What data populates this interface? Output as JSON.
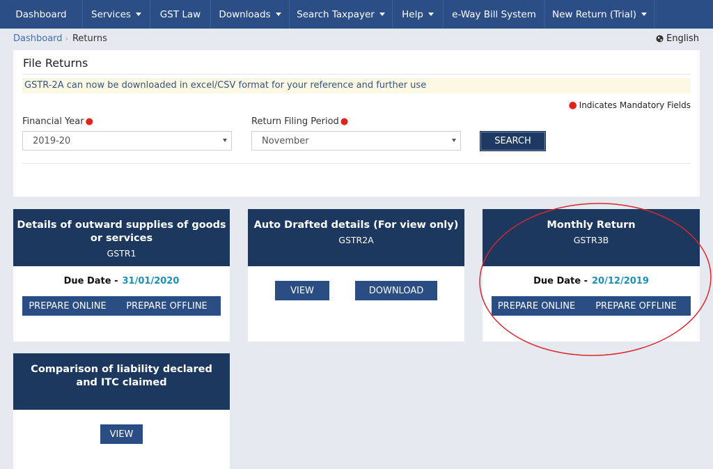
{
  "nav": {
    "items": [
      {
        "label": "Dashboard",
        "dropdown": false
      },
      {
        "label": "Services",
        "dropdown": true
      },
      {
        "label": "GST Law",
        "dropdown": false
      },
      {
        "label": "Downloads",
        "dropdown": true
      },
      {
        "label": "Search Taxpayer",
        "dropdown": true
      },
      {
        "label": "Help",
        "dropdown": true
      },
      {
        "label": "e-Way Bill System",
        "dropdown": false
      },
      {
        "label": "New Return (Trial)",
        "dropdown": true
      }
    ]
  },
  "breadcrumb": {
    "home": "Dashboard",
    "current": "Returns"
  },
  "language": "English",
  "file_returns": {
    "title": "File Returns",
    "notice": "GSTR-2A can now be downloaded in excel/CSV format for your reference and further use",
    "mandatory_note": "Indicates Mandatory Fields",
    "financial_year": {
      "label": "Financial Year",
      "value": "2019-20"
    },
    "filing_period": {
      "label": "Return Filing Period",
      "value": "November"
    },
    "search_label": "SEARCH"
  },
  "cards": {
    "gstr1": {
      "title": "Details of outward supplies of goods or services",
      "form": "GSTR1",
      "due_label": "Due Date -",
      "due_date": "31/01/2020",
      "prepare_online": "PREPARE ONLINE",
      "prepare_offline": "PREPARE OFFLINE"
    },
    "gstr2a": {
      "title": "Auto Drafted details (For view only)",
      "form": "GSTR2A",
      "view": "VIEW",
      "download": "DOWNLOAD"
    },
    "gstr3b": {
      "title": "Monthly Return",
      "form": "GSTR3B",
      "due_label": "Due Date -",
      "due_date": "20/12/2019",
      "prepare_online": "PREPARE ONLINE",
      "prepare_offline": "PREPARE OFFLINE"
    },
    "comparison": {
      "title": "Comparison of liability declared and ITC claimed",
      "view": "VIEW"
    }
  },
  "colors": {
    "nav_bg": "#2c4e86",
    "card_header": "#1d385e",
    "button": "#2a4d84",
    "due_date": "#1d8fb5",
    "required_marker": "#e2231a",
    "annotation_circle": "#d9262c"
  }
}
